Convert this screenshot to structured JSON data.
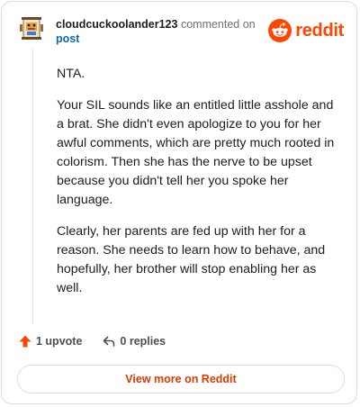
{
  "header": {
    "username": "cloudcuckoolander123",
    "action": "commented on",
    "post_link": "post"
  },
  "brand": {
    "wordmark": "reddit",
    "icon": "reddit-snoo-icon",
    "color": "#ff4500"
  },
  "comment": {
    "paragraphs": [
      "NTA.",
      "Your SIL sounds like an entitled little asshole and a brat. She didn't even apologize to you for her awful comments, which are pretty much rooted in colorism. Then she has the nerve to be upset because you didn't tell her you spoke her language.",
      "Clearly, her parents are fed up with her for a reason. She needs to learn how to behave, and hopefully, her brother will stop enabling her as well."
    ]
  },
  "footer": {
    "upvote_label": "1 upvote",
    "upvote_icon": "upvote-arrow-icon",
    "replies_label": "0 replies",
    "replies_icon": "reply-icon"
  },
  "cta": {
    "label": "View more on Reddit"
  }
}
